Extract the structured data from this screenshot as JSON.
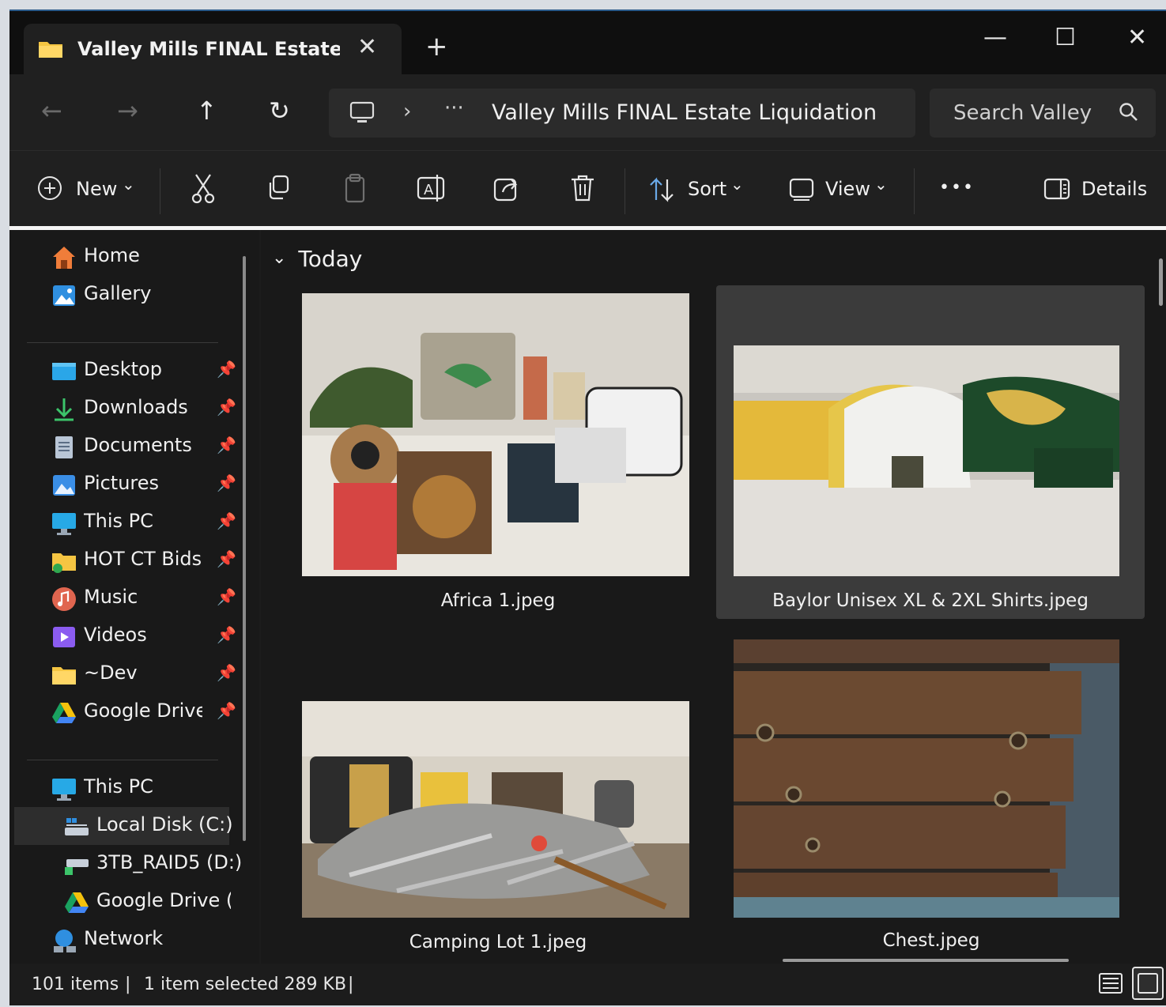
{
  "window": {
    "tab_title": "Valley Mills FINAL Estate Liquidation",
    "close_tab": "✕",
    "new_tab": "+",
    "minimize": "—",
    "maximize": "☐",
    "close": "✕"
  },
  "nav": {
    "back": "←",
    "forward": "→",
    "up": "↑",
    "refresh": "↻",
    "chevron": "›",
    "overflow": "···",
    "path": "Valley Mills FINAL Estate Liquidation",
    "search_placeholder": "Search Valley"
  },
  "toolbar": {
    "new_label": "New",
    "sort_label": "Sort",
    "view_label": "View",
    "more_label": "•••",
    "details_label": "Details",
    "dropdown": "⌄"
  },
  "sidebar": {
    "top": [
      {
        "label": "Home",
        "icon": "home-icon"
      },
      {
        "label": "Gallery",
        "icon": "gallery-icon"
      }
    ],
    "pinned": [
      {
        "label": "Desktop",
        "icon": "desktop-icon"
      },
      {
        "label": "Downloads",
        "icon": "downloads-icon"
      },
      {
        "label": "Documents",
        "icon": "documents-icon"
      },
      {
        "label": "Pictures",
        "icon": "pictures-icon"
      },
      {
        "label": "This PC",
        "icon": "this-pc-icon"
      },
      {
        "label": "HOT CT Bids",
        "icon": "folder-icon"
      },
      {
        "label": "Music",
        "icon": "music-icon"
      },
      {
        "label": "Videos",
        "icon": "videos-icon"
      },
      {
        "label": "~Dev",
        "icon": "folder-icon"
      },
      {
        "label": "Google Drive (",
        "icon": "google-drive-icon"
      }
    ],
    "pin_glyph": "📌",
    "this_pc": "This PC",
    "drives": [
      {
        "label": "Local Disk (C:)",
        "icon": "local-disk-icon"
      },
      {
        "label": "3TB_RAID5 (D:)",
        "icon": "network-drive-icon"
      },
      {
        "label": "Google Drive (G:",
        "icon": "google-drive-icon"
      }
    ],
    "network": "Network"
  },
  "content": {
    "group_chevron": "⌄",
    "group_label": "Today",
    "files": [
      {
        "name": "Africa  1.jpeg",
        "selected": false
      },
      {
        "name": "Baylor Unisex XL & 2XL Shirts.jpeg",
        "selected": true
      },
      {
        "name": "Camping Lot  1.jpeg",
        "selected": false
      },
      {
        "name": "Chest.jpeg",
        "selected": false
      }
    ]
  },
  "status": {
    "item_count": "101 items",
    "selection": "1 item selected  289 KB",
    "divider": "|"
  },
  "colors": {
    "accent": "#4c9be8",
    "folder_yellow": "#f5c542",
    "background": "#191919"
  }
}
